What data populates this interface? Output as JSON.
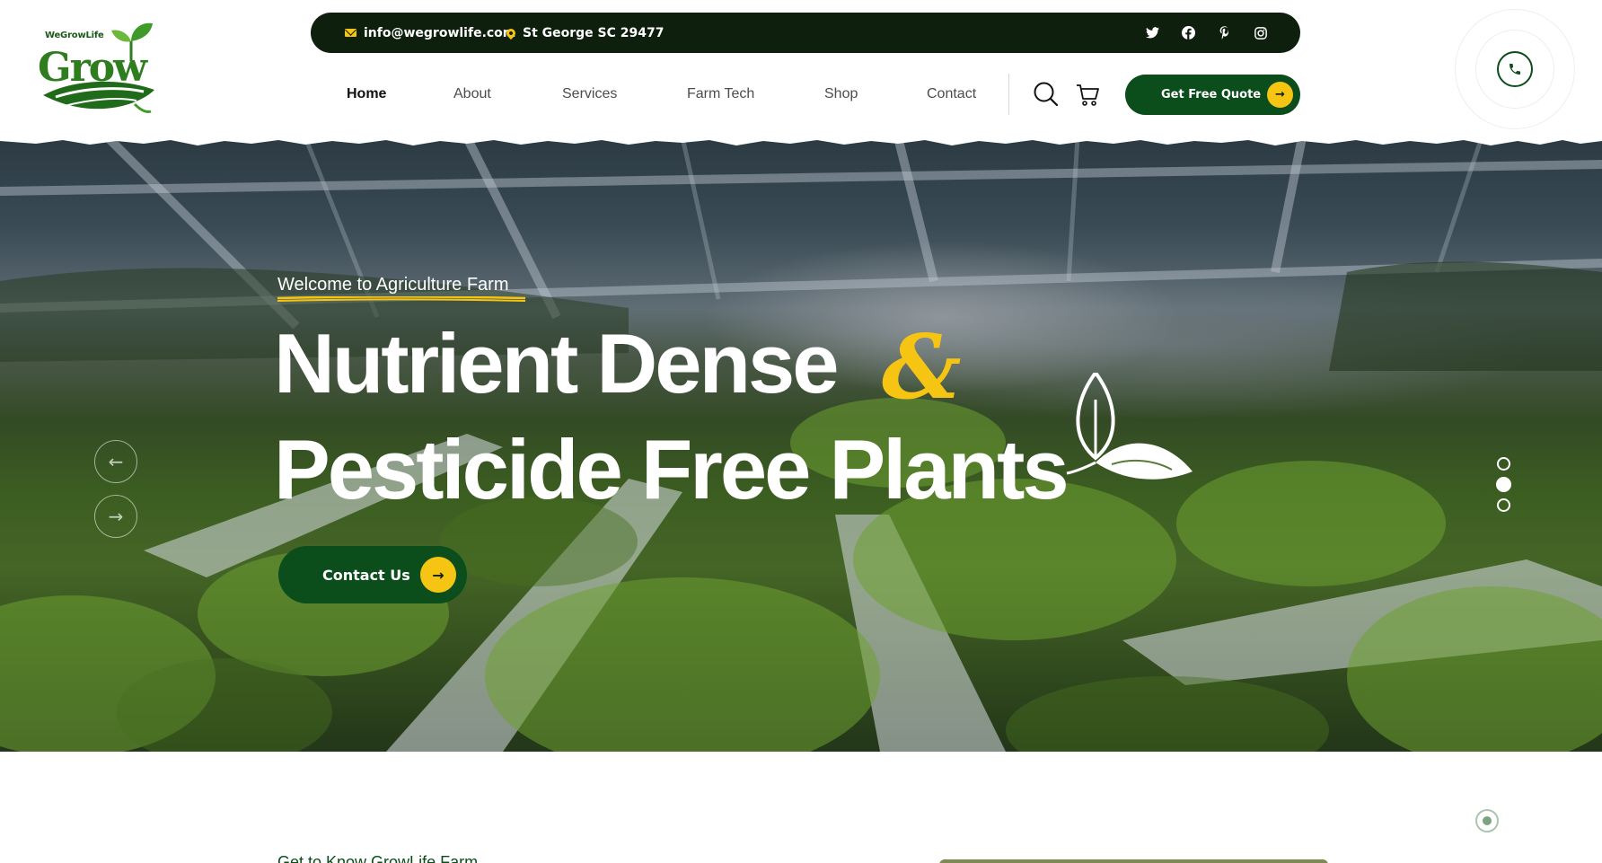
{
  "brand": {
    "small_text": "WeGrowLife",
    "word": "Grow"
  },
  "topbar": {
    "email": "info@wegrowlife.com",
    "location": "St George SC 29477",
    "socials": [
      "twitter-icon",
      "facebook-icon",
      "pinterest-icon",
      "instagram-icon"
    ]
  },
  "nav": {
    "items": [
      "Home",
      "About",
      "Services",
      "Farm Tech",
      "Shop",
      "Contact"
    ],
    "active": "Home",
    "quote_label": "Get Free Quote"
  },
  "hero": {
    "kicker": "Welcome to Agriculture Farm",
    "headline_line1": "Nutrient Dense",
    "amp": "&",
    "headline_line2": "Pesticide Free Plants",
    "cta_label": "Contact Us",
    "slides_total": 3,
    "active_slide": 2
  },
  "about": {
    "kicker": "Get to Know GrowLife Farm"
  },
  "colors": {
    "primary_green": "#0b4d1b",
    "dark_bar": "#0e1f0e",
    "accent_yellow": "#f6c514"
  }
}
